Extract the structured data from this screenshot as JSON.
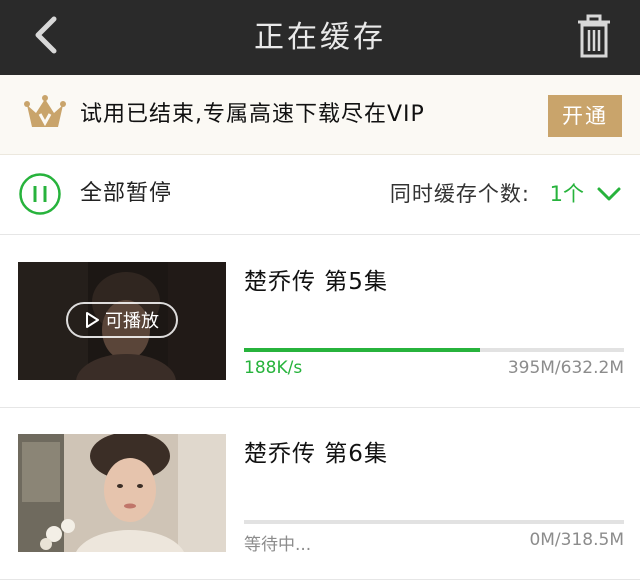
{
  "header": {
    "title": "正在缓存",
    "back_icon": "chevron-left-icon",
    "delete_icon": "trash-icon"
  },
  "vip_banner": {
    "text": "试用已结束,专属高速下载尽在VIP",
    "button_label": "开通",
    "icon": "crown-icon",
    "accent_color": "#c9a46b"
  },
  "controls": {
    "pause_all_label": "全部暂停",
    "concurrent_label": "同时缓存个数:",
    "concurrent_value": "1个",
    "accent_color": "#27b33c"
  },
  "downloads": [
    {
      "title": "楚乔传 第5集",
      "play_label": "可播放",
      "speed": "188K/s",
      "size": "395M/632.2M",
      "progress": 0.62
    },
    {
      "title": "楚乔传 第6集",
      "status": "等待中...",
      "size": "0M/318.5M",
      "progress": 0
    }
  ]
}
